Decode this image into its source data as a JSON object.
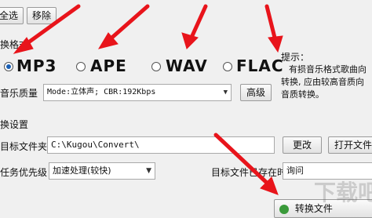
{
  "toolbar": {
    "select_all": "全选",
    "remove": "移除"
  },
  "format": {
    "section_title": "换格式",
    "options": [
      {
        "label": "MP3",
        "selected": true
      },
      {
        "label": "APE",
        "selected": false
      },
      {
        "label": "WAV",
        "selected": false
      },
      {
        "label": "FLAC",
        "selected": false
      }
    ]
  },
  "tip": {
    "title": "提示：",
    "lines": [
      "有损音乐格式歌曲向",
      "转换, 应由较高音质向",
      "音质转换。"
    ]
  },
  "quality": {
    "label": "音乐质量",
    "value": "Mode:立体声; CBR:192Kbps",
    "advanced": "高级"
  },
  "settings": {
    "section_title": "换设置"
  },
  "target": {
    "label": "目标文件夹",
    "path": "C:\\Kugou\\Convert\\",
    "change": "更改",
    "open": "打开文件"
  },
  "priority": {
    "label": "任务优先级",
    "value": "加速处理(较快)"
  },
  "exists": {
    "label": "目标文件已存在时",
    "value": "询问"
  },
  "convert": {
    "label": "转换文件"
  },
  "watermark": "下载吧",
  "colors": {
    "arrow": "#e8141b",
    "accent": "#1a5fb4"
  }
}
